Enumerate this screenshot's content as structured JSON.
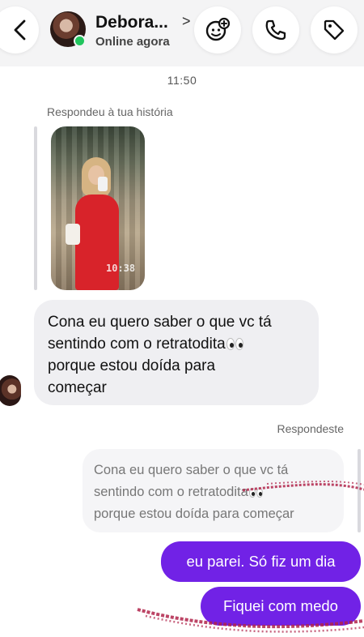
{
  "header": {
    "contact_name": "Debora...",
    "name_chevron": ">",
    "status": "Online agora",
    "buttons": {
      "back_icon": "chevron-left-icon",
      "avatar_icon": "avatar-sticker-icon",
      "call_icon": "phone-icon",
      "tag_icon": "tag-icon"
    },
    "online_color": "#22c55e"
  },
  "timestamp": "11:50",
  "story_reply": {
    "label": "Respondeu à tua história",
    "story_time": "10:38"
  },
  "incoming_message": {
    "line1": "Cona eu quero saber o que vc tá",
    "line2": "sentindo com o retratodita",
    "line3": "porque estou doída para",
    "line4": "começar"
  },
  "my_reply": {
    "label": "Respondeste",
    "quote_line1": "Cona eu quero saber o que vc tá",
    "quote_line2": "sentindo com o retratodita",
    "quote_line3": "porque estou doída para começar"
  },
  "outgoing_messages": [
    {
      "text": "eu parei. Só fiz um dia"
    },
    {
      "text": "Fiquei com medo"
    }
  ],
  "colors": {
    "outgoing_bubble": "#7122e6",
    "incoming_bubble": "#efeff2",
    "scribble": "#b0234a"
  }
}
